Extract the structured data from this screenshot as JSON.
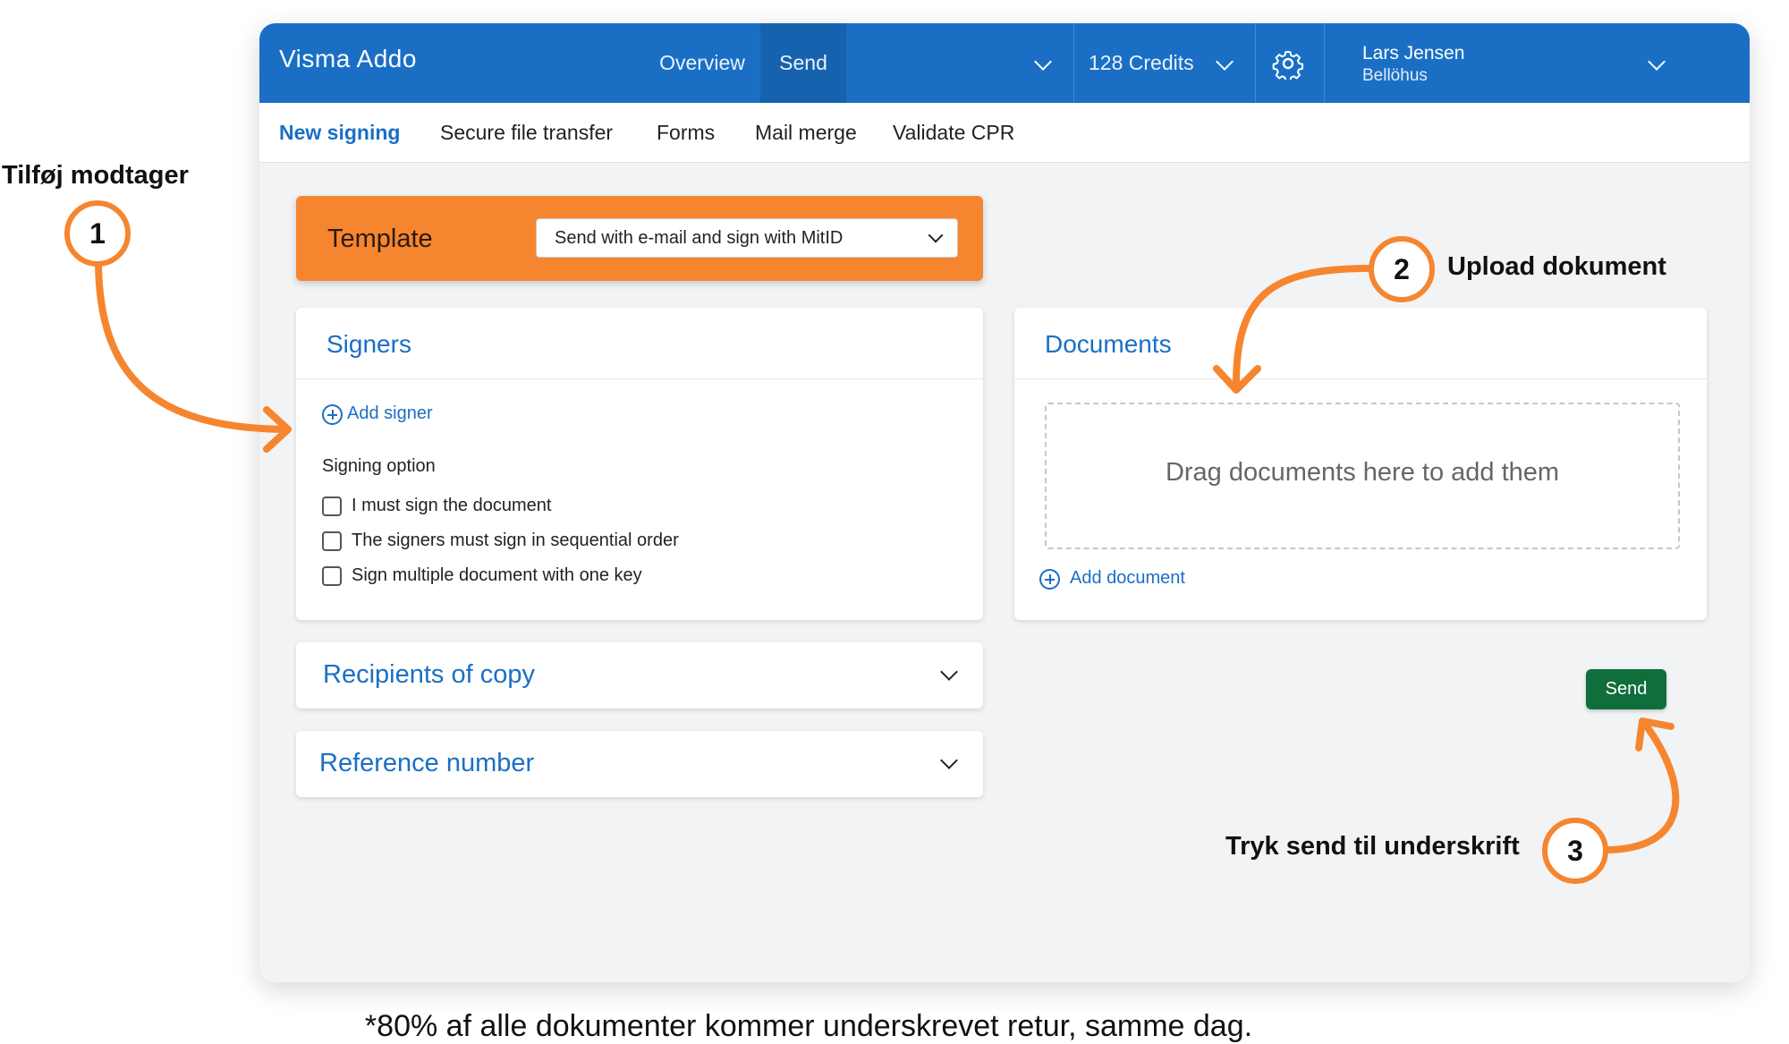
{
  "header": {
    "brand": "Visma  Addo",
    "nav": [
      "Overview",
      "Send"
    ],
    "credits": "128 Credits",
    "user_name": "Lars Jensen",
    "user_org": "Bellöhus"
  },
  "subnav": [
    "New signing",
    "Secure file transfer",
    "Forms",
    "Mail merge",
    "Validate CPR"
  ],
  "template": {
    "label": "Template",
    "selected": "Send with e-mail and sign with MitID"
  },
  "signers": {
    "title": "Signers",
    "add_label": "Add signer",
    "option_heading": "Signing option",
    "options": [
      "I must sign the document",
      "The signers must sign in sequential order",
      "Sign multiple document with one key"
    ]
  },
  "recipients": {
    "title": "Recipients of copy"
  },
  "reference": {
    "title": "Reference number"
  },
  "documents": {
    "title": "Documents",
    "drop_text": "Drag documents here to add them",
    "add_label": "Add document"
  },
  "send_label": "Send",
  "annotations": {
    "step1_label": "Tilføj modtager",
    "step1_num": "1",
    "step2_label": "Upload dokument",
    "step2_num": "2",
    "step3_label": "Tryk send til underskrift",
    "step3_num": "3"
  },
  "footnote": "*80% af alle dokumenter kommer underskrevet retur, samme dag.",
  "colors": {
    "primary": "#1a6fc5",
    "accent": "#f5862f",
    "send": "#0f6e3c",
    "background": "#f2f3f5"
  }
}
